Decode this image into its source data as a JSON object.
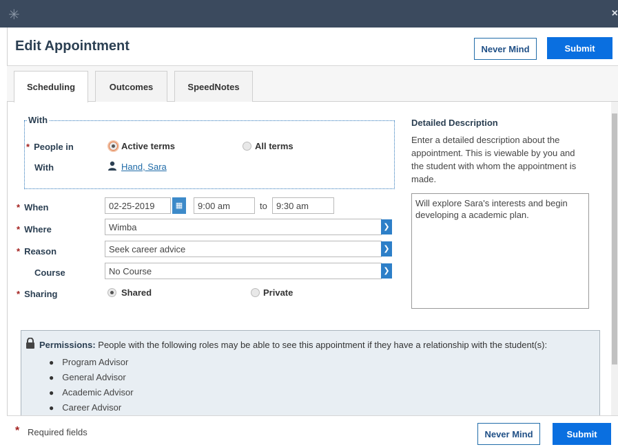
{
  "dialog": {
    "title": "Edit Appointment",
    "never_mind_label": "Never Mind",
    "submit_label": "Submit"
  },
  "tabs": [
    {
      "label": "Scheduling",
      "active": true
    },
    {
      "label": "Outcomes",
      "active": false
    },
    {
      "label": "SpeedNotes",
      "active": false
    }
  ],
  "with_section": {
    "legend": "With",
    "people_in_label": "People in",
    "options": [
      {
        "label": "Active terms",
        "selected": true
      },
      {
        "label": "All terms",
        "selected": false
      }
    ],
    "with_label": "With",
    "student_name": "Hand, Sara"
  },
  "when": {
    "label": "When",
    "date": "02-25-2019",
    "start_time": "9:00 am",
    "to_label": "to",
    "end_time": "9:30 am"
  },
  "where": {
    "label": "Where",
    "value": "Wimba"
  },
  "reason": {
    "label": "Reason",
    "value": "Seek career advice"
  },
  "course": {
    "label": "Course",
    "value": "No Course"
  },
  "sharing": {
    "label": "Sharing",
    "options": [
      {
        "label": "Shared",
        "selected": true
      },
      {
        "label": "Private",
        "selected": false
      }
    ]
  },
  "description": {
    "title": "Detailed Description",
    "help": "Enter a detailed description about the appointment. This is viewable by you and the student with whom the appointment is made.",
    "value": "Will explore Sara's interests and begin developing a academic plan."
  },
  "permissions": {
    "label": "Permissions:",
    "text": "People with the following roles may be able to see this appointment if they have a relationship with the student(s):",
    "roles": [
      "Program Advisor",
      "General Advisor",
      "Academic Advisor",
      "Career Advisor"
    ]
  },
  "footer": {
    "required_note": "Required fields"
  },
  "required_marker": "*",
  "colors": {
    "titlebar": "#3b4a5e",
    "primary": "#0a6fe0",
    "required": "#a3211f",
    "heading": "#2b3f52"
  }
}
